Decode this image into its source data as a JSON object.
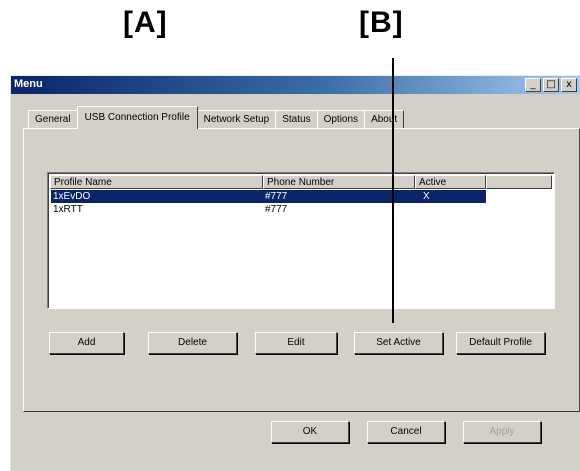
{
  "callouts": {
    "a": "[A]",
    "b": "[B]"
  },
  "window": {
    "title": "Menu",
    "controls": {
      "minimize": "_",
      "maximize": "□",
      "close": "x"
    }
  },
  "tabs": [
    {
      "label": "General"
    },
    {
      "label": "USB Connection Profile",
      "active": true
    },
    {
      "label": "Network Setup"
    },
    {
      "label": "Status"
    },
    {
      "label": "Options"
    },
    {
      "label": "About"
    }
  ],
  "list": {
    "columns": [
      "Profile Name",
      "Phone Number",
      "Active"
    ],
    "rows": [
      {
        "profile": "1xEvDO",
        "phone": "#777",
        "active": "X",
        "selected": true
      },
      {
        "profile": "1xRTT",
        "phone": "#777",
        "active": "",
        "selected": false
      }
    ]
  },
  "profile_buttons": {
    "add": "Add",
    "delete": "Delete",
    "edit": "Edit",
    "set_active": "Set Active",
    "default_profile": "Default Profile"
  },
  "dialog_buttons": {
    "ok": "OK",
    "cancel": "Cancel",
    "apply": "Apply"
  },
  "colors": {
    "selection": "#0a246a",
    "face": "#d4d0c8",
    "title_start": "#0a246a"
  }
}
